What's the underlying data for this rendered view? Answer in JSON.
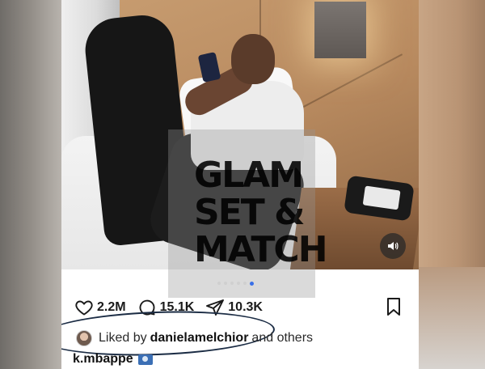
{
  "post": {
    "watermark_lines": [
      "GLAM",
      "SET &",
      "MATCH"
    ],
    "carousel": {
      "count": 6,
      "active_index": 5
    },
    "stats": {
      "likes": "2.2M",
      "comments": "15.1K",
      "shares": "10.3K"
    },
    "liked_by": {
      "prefix": "Liked by",
      "user": "danielamelchior",
      "suffix": "and others"
    },
    "caption_user": "k.mbappe"
  },
  "colors": {
    "carousel_active": "#3a70e8",
    "annotation_circle": "#1b2c44"
  }
}
